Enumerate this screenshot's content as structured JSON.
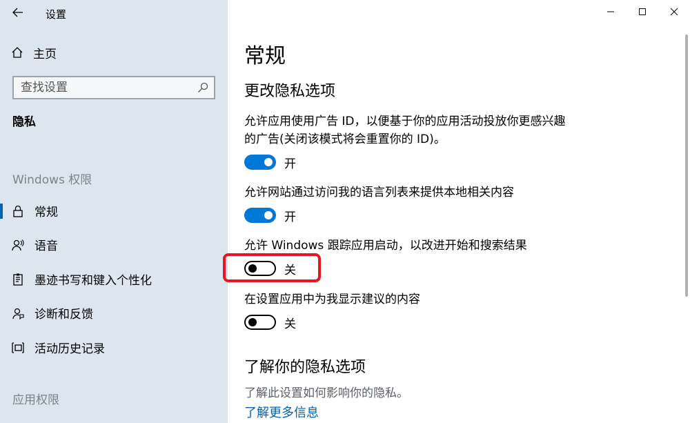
{
  "window": {
    "title": "设置",
    "controls": {
      "minimize_icon": "minimize-icon",
      "maximize_icon": "maximize-icon",
      "close_icon": "close-icon"
    }
  },
  "sidebar": {
    "home_label": "主页",
    "search_placeholder": "查找设置",
    "current_section": "隐私",
    "groups": {
      "windows_permissions": "Windows 权限",
      "app_permissions": "应用权限"
    },
    "items": [
      {
        "label": "常规",
        "icon": "lock-icon",
        "selected": true
      },
      {
        "label": "语音",
        "icon": "speech-icon",
        "selected": false
      },
      {
        "label": "墨迹书写和键入个性化",
        "icon": "inking-icon",
        "selected": false
      },
      {
        "label": "诊断和反馈",
        "icon": "feedback-icon",
        "selected": false
      },
      {
        "label": "活动历史记录",
        "icon": "activity-history-icon",
        "selected": false
      }
    ]
  },
  "main": {
    "title": "常规",
    "subtitle": "更改隐私选项",
    "settings": [
      {
        "description": "允许应用使用广告 ID，以便基于你的应用活动投放你更感兴趣的广告(关闭该模式将会重置你的 ID)。",
        "state": "开",
        "on": true
      },
      {
        "description": "允许网站通过访问我的语言列表来提供本地相关内容",
        "state": "开",
        "on": true
      },
      {
        "description": "允许 Windows 跟踪应用启动，以改进开始和搜索结果",
        "state": "关",
        "on": false
      },
      {
        "description": "在设置应用中为我显示建议的内容",
        "state": "关",
        "on": false
      }
    ],
    "learn": {
      "title": "了解你的隐私选项",
      "description": "了解此设置如何影响你的隐私。",
      "link": "了解更多信息"
    }
  },
  "colors": {
    "sidebar_bg": "#dde6ee",
    "accent": "#0078d7",
    "highlight": "#e8141f",
    "link": "#0063b1"
  }
}
